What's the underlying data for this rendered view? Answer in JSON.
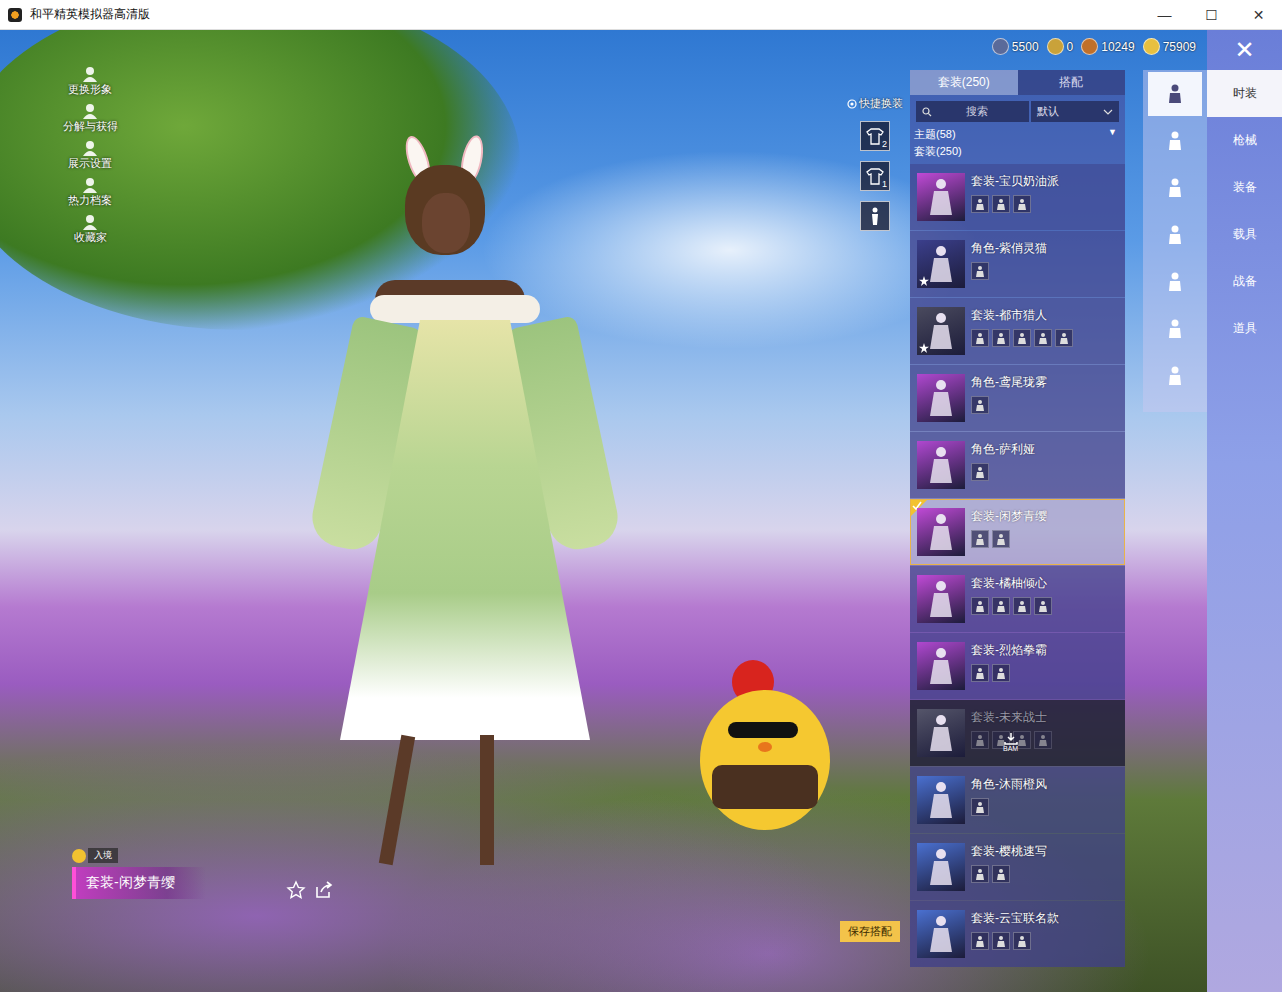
{
  "window": {
    "title": "和平精英模拟器高清版",
    "controls": [
      "—",
      "☐",
      "✕"
    ]
  },
  "currencies": [
    {
      "amount": "5500",
      "color": "#5a6a9a"
    },
    {
      "amount": "0",
      "color": "#c9a23a"
    },
    {
      "amount": "10249",
      "color": "#c0702a"
    },
    {
      "amount": "75909",
      "color": "#e8c040"
    }
  ],
  "left_menu": [
    {
      "label": "更换形象"
    },
    {
      "label": "分解与获得"
    },
    {
      "label": "展示设置"
    },
    {
      "label": "热力档案"
    },
    {
      "label": "收藏家"
    }
  ],
  "quick_change": {
    "label": "快捷换装",
    "slots": [
      "2",
      "1"
    ]
  },
  "tabs": [
    {
      "label": "套装(250)",
      "selected": true
    },
    {
      "label": "搭配",
      "selected": false
    }
  ],
  "search": {
    "placeholder": "搜索",
    "sort": "默认"
  },
  "filters": [
    {
      "label": "主题(58)",
      "arrow": "▼"
    },
    {
      "label": "套装(250)",
      "arrow": ""
    }
  ],
  "outfits": [
    {
      "name": "套装-宝贝奶油派",
      "pieces": 3,
      "starred": false,
      "selected": false,
      "equipped": false,
      "disabled": false,
      "color": "#c04ad6"
    },
    {
      "name": "角色-紫俏灵猫",
      "pieces": 1,
      "starred": true,
      "selected": false,
      "equipped": false,
      "disabled": false,
      "color": "#3b3f8c"
    },
    {
      "name": "套装-都市猎人",
      "pieces": 5,
      "starred": true,
      "selected": false,
      "equipped": false,
      "disabled": false,
      "color": "#4a4a5e"
    },
    {
      "name": "角色-鸢尾珑雾",
      "pieces": 1,
      "starred": false,
      "selected": false,
      "equipped": false,
      "disabled": false,
      "color": "#b048d0"
    },
    {
      "name": "角色-萨利娅",
      "pieces": 1,
      "starred": false,
      "selected": false,
      "equipped": false,
      "disabled": false,
      "color": "#b048d0"
    },
    {
      "name": "套装-闲梦青缨",
      "pieces": 2,
      "starred": false,
      "selected": true,
      "equipped": true,
      "disabled": false,
      "color": "#c04ad6"
    },
    {
      "name": "套装-橘柚倾心",
      "pieces": 4,
      "starred": false,
      "selected": false,
      "equipped": false,
      "disabled": false,
      "color": "#c04ad6"
    },
    {
      "name": "套装-烈焰拳霸",
      "pieces": 2,
      "starred": false,
      "selected": false,
      "equipped": false,
      "disabled": false,
      "color": "#b048d0"
    },
    {
      "name": "套装-未来战士",
      "pieces": 4,
      "starred": false,
      "selected": false,
      "equipped": false,
      "disabled": true,
      "color": "#55556a",
      "download": "BAM"
    },
    {
      "name": "角色-沐雨橙风",
      "pieces": 1,
      "starred": false,
      "selected": false,
      "equipped": false,
      "disabled": false,
      "color": "#4a70d0"
    },
    {
      "name": "套装-樱桃速写",
      "pieces": 2,
      "starred": false,
      "selected": false,
      "equipped": false,
      "disabled": false,
      "color": "#4a70d0"
    },
    {
      "name": "套装-云宝联名款",
      "pieces": 3,
      "starred": false,
      "selected": false,
      "equipped": false,
      "disabled": false,
      "color": "#4a70d0"
    }
  ],
  "part_filters": [
    {
      "selected": true
    },
    {
      "selected": false
    },
    {
      "selected": false
    },
    {
      "selected": false
    },
    {
      "selected": false
    },
    {
      "selected": false
    },
    {
      "selected": false
    }
  ],
  "categories": [
    {
      "label": "时装",
      "selected": true
    },
    {
      "label": "枪械",
      "selected": false
    },
    {
      "label": "装备",
      "selected": false
    },
    {
      "label": "载具",
      "selected": false
    },
    {
      "label": "战备",
      "selected": false
    },
    {
      "label": "道具",
      "selected": false
    }
  ],
  "close": "✕",
  "current": {
    "badge": "入境",
    "name": "套装-闲梦青缨"
  },
  "save_button": "保存搭配"
}
